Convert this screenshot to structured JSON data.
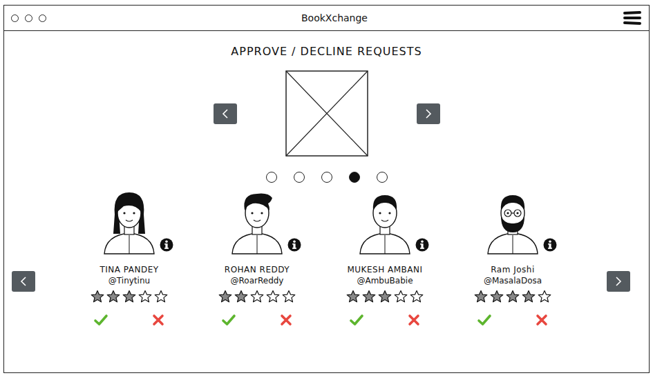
{
  "window": {
    "title": "BookXchange"
  },
  "page": {
    "heading": "APPROVE / DECLINE REQUESTS"
  },
  "carousel": {
    "dots": [
      {
        "selected": false
      },
      {
        "selected": false
      },
      {
        "selected": false
      },
      {
        "selected": true
      },
      {
        "selected": false
      }
    ]
  },
  "requests": [
    {
      "name": "TINA PANDEY",
      "handle": "@Tinytinu",
      "stars": 3
    },
    {
      "name": "ROHAN REDDY",
      "handle": "@RoarReddy",
      "stars": 2
    },
    {
      "name": "MUKESH AMBANI",
      "handle": "@AmbuBabie",
      "stars": 3
    },
    {
      "name": "Ram Joshi",
      "handle": "@MasalaDosa",
      "stars": 4
    }
  ]
}
